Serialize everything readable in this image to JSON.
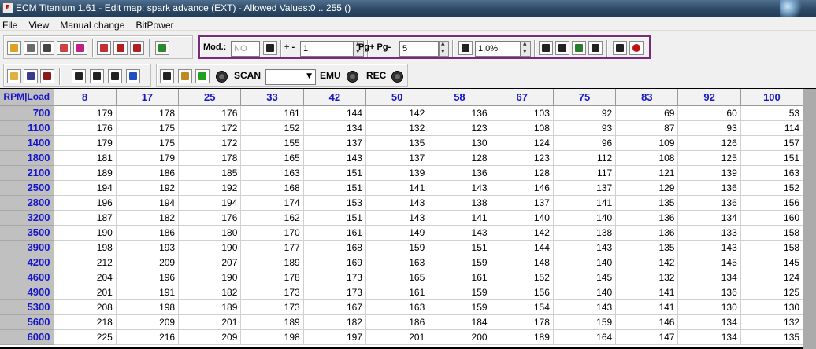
{
  "window": {
    "title": "ECM Titanium 1.61 - Edit map: spark advance (EXT) - Allowed Values:0 .. 255 ()"
  },
  "menu": [
    {
      "label": "File"
    },
    {
      "label": "View"
    },
    {
      "label": "Manual change"
    },
    {
      "label": "BitPower"
    }
  ],
  "toolbar": {
    "mod_label": "Mod.:",
    "mod_value": "NO",
    "plusminus_label": "+ -",
    "step_value": "1",
    "page_label": "Pg+ Pg-",
    "page_value": "5",
    "percent_value": "1,0%",
    "scan_label": "SCAN",
    "scan_value": "",
    "emu_label": "EMU",
    "rec_label": "REC"
  },
  "icons": {
    "open-folder-icon": {
      "color": "#e0b040"
    },
    "save-icon": {
      "color": "#3a3a8a"
    },
    "save-as-icon": {
      "color": "#8a1a1a"
    },
    "chip-icon": {
      "color": "#2050c0"
    }
  },
  "grid": {
    "corner": "RPM|Load",
    "columns": [
      "8",
      "17",
      "25",
      "33",
      "42",
      "50",
      "58",
      "67",
      "75",
      "83",
      "92",
      "100"
    ],
    "rows": [
      {
        "rpm": "700",
        "values": [
          179,
          178,
          176,
          161,
          144,
          142,
          136,
          103,
          92,
          69,
          60,
          53
        ]
      },
      {
        "rpm": "1100",
        "values": [
          176,
          175,
          172,
          152,
          134,
          132,
          123,
          108,
          93,
          87,
          93,
          114
        ]
      },
      {
        "rpm": "1400",
        "values": [
          179,
          175,
          172,
          155,
          137,
          135,
          130,
          124,
          96,
          109,
          126,
          157
        ]
      },
      {
        "rpm": "1800",
        "values": [
          181,
          179,
          178,
          165,
          143,
          137,
          128,
          123,
          112,
          108,
          125,
          151
        ]
      },
      {
        "rpm": "2100",
        "values": [
          189,
          186,
          185,
          163,
          151,
          139,
          136,
          128,
          117,
          121,
          139,
          163
        ]
      },
      {
        "rpm": "2500",
        "values": [
          194,
          192,
          192,
          168,
          151,
          141,
          143,
          146,
          137,
          129,
          136,
          152
        ]
      },
      {
        "rpm": "2800",
        "values": [
          196,
          194,
          194,
          174,
          153,
          143,
          138,
          137,
          141,
          135,
          136,
          156
        ]
      },
      {
        "rpm": "3200",
        "values": [
          187,
          182,
          176,
          162,
          151,
          143,
          141,
          140,
          140,
          136,
          134,
          160
        ]
      },
      {
        "rpm": "3500",
        "values": [
          190,
          186,
          180,
          170,
          161,
          149,
          143,
          142,
          138,
          136,
          133,
          158
        ]
      },
      {
        "rpm": "3900",
        "values": [
          198,
          193,
          190,
          177,
          168,
          159,
          151,
          144,
          143,
          135,
          143,
          158
        ]
      },
      {
        "rpm": "4200",
        "values": [
          212,
          209,
          207,
          189,
          169,
          163,
          159,
          148,
          140,
          142,
          145,
          145
        ]
      },
      {
        "rpm": "4600",
        "values": [
          204,
          196,
          190,
          178,
          173,
          165,
          161,
          152,
          145,
          132,
          134,
          124
        ]
      },
      {
        "rpm": "4900",
        "values": [
          201,
          191,
          182,
          173,
          173,
          161,
          159,
          156,
          140,
          141,
          136,
          125
        ]
      },
      {
        "rpm": "5300",
        "values": [
          208,
          198,
          189,
          173,
          167,
          163,
          159,
          154,
          143,
          141,
          130,
          130
        ]
      },
      {
        "rpm": "5600",
        "values": [
          218,
          209,
          201,
          189,
          182,
          186,
          184,
          178,
          159,
          146,
          134,
          132
        ]
      },
      {
        "rpm": "6000",
        "values": [
          225,
          216,
          209,
          198,
          197,
          201,
          200,
          189,
          164,
          147,
          134,
          135
        ]
      }
    ]
  }
}
